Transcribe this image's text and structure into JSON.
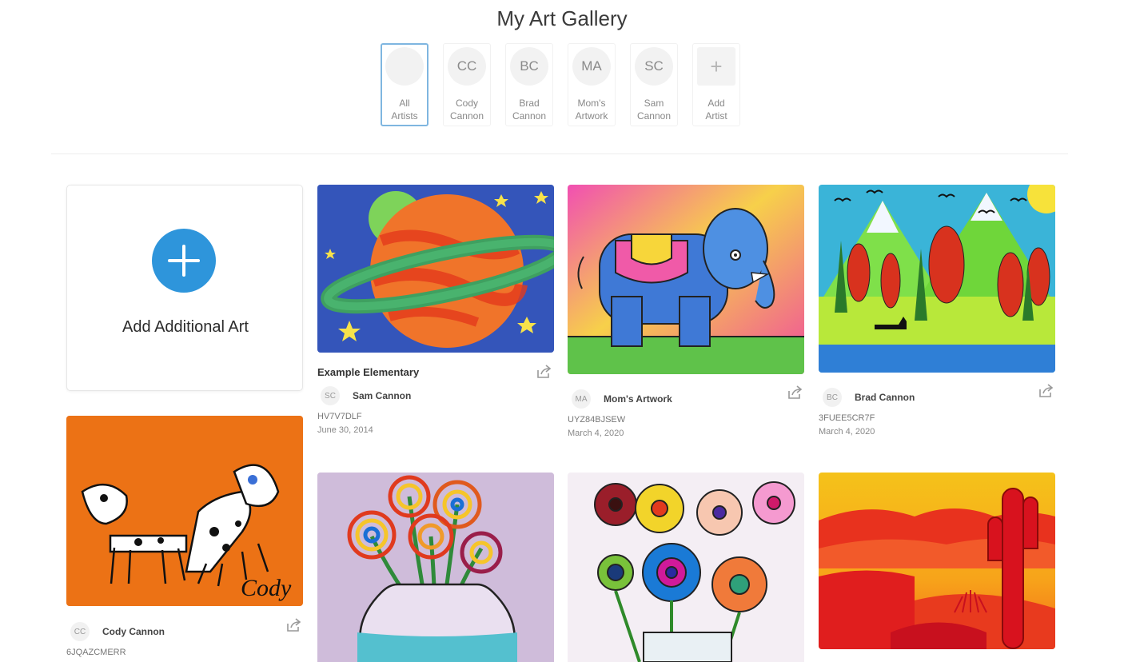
{
  "page": {
    "title": "My Art Gallery"
  },
  "artists": [
    {
      "initials": "",
      "name_line1": "All",
      "name_line2": "Artists",
      "selected": true
    },
    {
      "initials": "CC",
      "name_line1": "Cody",
      "name_line2": "Cannon",
      "selected": false
    },
    {
      "initials": "BC",
      "name_line1": "Brad",
      "name_line2": "Cannon",
      "selected": false
    },
    {
      "initials": "MA",
      "name_line1": "Mom's",
      "name_line2": "Artwork",
      "selected": false
    },
    {
      "initials": "SC",
      "name_line1": "Sam",
      "name_line2": "Cannon",
      "selected": false
    },
    {
      "initials": "+",
      "name_line1": "Add",
      "name_line2": "Artist",
      "selected": false
    }
  ],
  "add_card": {
    "label": "Add Additional Art",
    "accent": "#2e95db"
  },
  "artworks": [
    {
      "subject": "planet",
      "title": "Example Elementary",
      "artist_initials": "SC",
      "artist_name": "Sam Cannon",
      "code": "HV7V7DLF",
      "date": "June 30, 2014"
    },
    {
      "subject": "elephant",
      "title": "",
      "artist_initials": "MA",
      "artist_name": "Mom's Artwork",
      "code": "UYZ84BJSEW",
      "date": "March 4, 2020"
    },
    {
      "subject": "forest",
      "title": "",
      "artist_initials": "BC",
      "artist_name": "Brad Cannon",
      "code": "3FUEE5CR7F",
      "date": "March 4, 2020"
    },
    {
      "subject": "dogs",
      "title": "",
      "artist_initials": "CC",
      "artist_name": "Cody Cannon",
      "code": "6JQAZCMERR",
      "date": ""
    },
    {
      "subject": "flowers-vase",
      "title": "",
      "artist_initials": "",
      "artist_name": "",
      "code": "",
      "date": ""
    },
    {
      "subject": "flowers-drawing",
      "title": "",
      "artist_initials": "",
      "artist_name": "",
      "code": "",
      "date": ""
    },
    {
      "subject": "desert-cactus",
      "title": "",
      "artist_initials": "",
      "artist_name": "",
      "code": "",
      "date": ""
    }
  ],
  "art_signature": "Cody",
  "icons": {
    "share": "share-icon",
    "add": "plus-icon"
  }
}
